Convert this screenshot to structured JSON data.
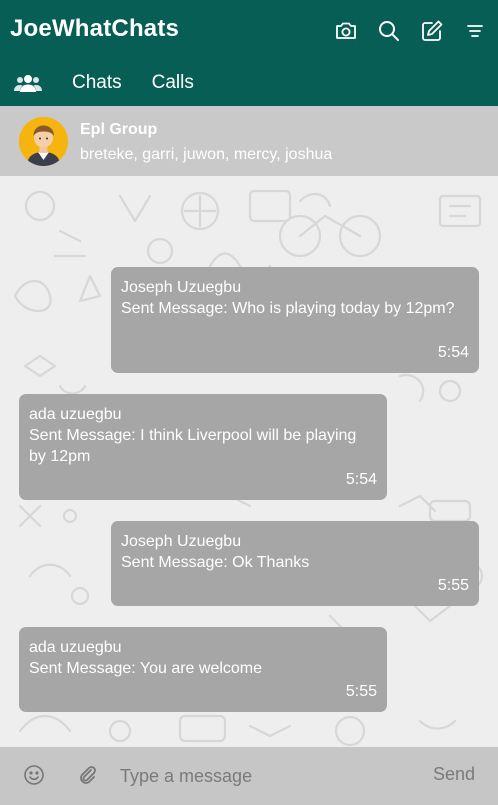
{
  "app": {
    "title": "JoeWhatChats"
  },
  "header_icons": [
    "camera-icon",
    "search-icon",
    "compose-icon",
    "menu-icon"
  ],
  "tabs": [
    {
      "label": "Chats"
    },
    {
      "label": "Calls"
    }
  ],
  "group": {
    "name": "Epl Group",
    "members": "breteke, garri, juwon, mercy, joshua"
  },
  "messages": [
    {
      "sender": "Joseph Uzuegbu",
      "text": "Sent Message: Who is playing today by 12pm?",
      "time": "5:54",
      "side": "right"
    },
    {
      "sender": "ada uzuegbu",
      "text": "Sent Message: I think Liverpool will be playing by 12pm",
      "time": "5:54",
      "side": "left"
    },
    {
      "sender": "Joseph Uzuegbu",
      "text": "Sent Message: Ok Thanks",
      "time": "5:55",
      "side": "right"
    },
    {
      "sender": "ada uzuegbu",
      "text": "Sent Message: You are welcome",
      "time": "5:55",
      "side": "left"
    }
  ],
  "compose": {
    "placeholder": "Type a message",
    "send_label": "Send"
  },
  "colors": {
    "header": "#075e54",
    "bubble": "#a6a6a6",
    "compose_bar": "#c6c6c6",
    "group_header": "#c9c9c9"
  }
}
